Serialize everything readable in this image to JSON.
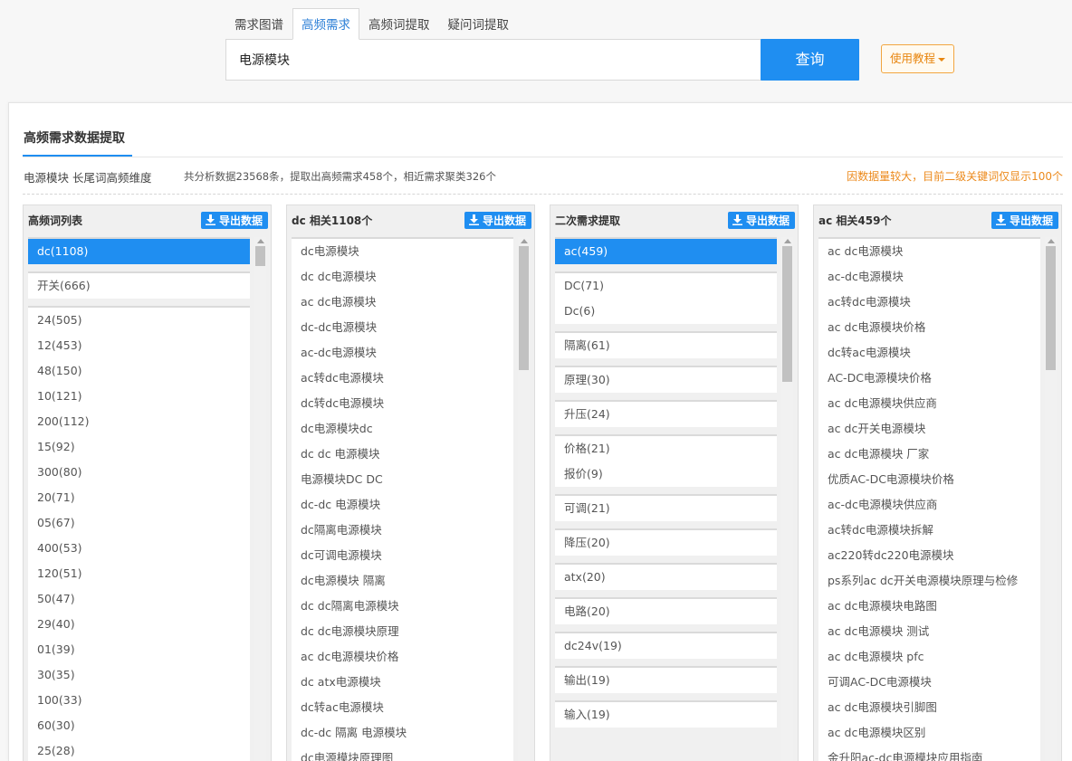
{
  "tabs": [
    "需求图谱",
    "高频需求",
    "高频词提取",
    "疑问词提取"
  ],
  "active_tab_index": 1,
  "search": {
    "value": "电源模块",
    "button_label": "查询"
  },
  "tutorial_label": "使用教程",
  "section": {
    "title": "高频需求数据提取",
    "keyword_dim": "电源模块 长尾词高频维度",
    "stats": "共分析数据23568条，提取出高频需求458个，相近需求聚类326个",
    "note": "因数据量较大，目前二级关键词仅显示100个"
  },
  "colors": {
    "accent": "#1f8ef1",
    "note": "#ec8a1c"
  },
  "export_label": "导出数据",
  "export_icon": "download-icon",
  "col1": {
    "title": "高频词列表",
    "groups": [
      [
        "dc(1108)"
      ],
      [
        "开关(666)"
      ],
      [
        "24(505)",
        "12(453)",
        "48(150)",
        "10(121)",
        "200(112)",
        "15(92)",
        "300(80)",
        "20(71)",
        "05(67)",
        "400(53)",
        "120(51)",
        "50(47)",
        "29(40)",
        "01(39)",
        "30(35)",
        "100(33)",
        "60(30)",
        "25(28)"
      ]
    ],
    "selected": "dc(1108)"
  },
  "col2": {
    "title": "dc 相关1108个",
    "items": [
      "dc电源模块",
      "dc dc电源模块",
      "ac dc电源模块",
      "dc-dc电源模块",
      "ac-dc电源模块",
      "ac转dc电源模块",
      "dc转dc电源模块",
      "dc电源模块dc",
      "dc dc 电源模块",
      "电源模块DC DC",
      "dc-dc 电源模块",
      "dc隔离电源模块",
      "dc可调电源模块",
      "dc电源模块 隔离",
      "dc dc隔离电源模块",
      "dc dc电源模块原理",
      "ac dc电源模块价格",
      "dc atx电源模块",
      "dc转ac电源模块",
      "dc-dc 隔离 电源模块",
      "dc电源模块原理图"
    ]
  },
  "col3": {
    "title": "二次需求提取",
    "groups": [
      [
        "ac(459)"
      ],
      [
        "DC(71)",
        "Dc(6)"
      ],
      [
        "隔离(61)"
      ],
      [
        "原理(30)"
      ],
      [
        "升压(24)"
      ],
      [
        "价格(21)",
        "报价(9)"
      ],
      [
        "可调(21)"
      ],
      [
        "降压(20)"
      ],
      [
        "atx(20)"
      ],
      [
        "电路(20)"
      ],
      [
        "dc24v(19)"
      ],
      [
        "输出(19)"
      ],
      [
        "输入(19)"
      ]
    ],
    "selected": "ac(459)"
  },
  "col4": {
    "title": "ac 相关459个",
    "items": [
      "ac dc电源模块",
      "ac-dc电源模块",
      "ac转dc电源模块",
      "ac dc电源模块价格",
      "dc转ac电源模块",
      "AC-DC电源模块价格",
      "ac dc电源模块供应商",
      "ac dc开关电源模块",
      "ac dc电源模块 厂家",
      "优质AC-DC电源模块价格",
      "ac-dc电源模块供应商",
      "ac转dc电源模块拆解",
      "ac220转dc220电源模块",
      "ps系列ac dc开关电源模块原理与检修",
      "ac dc电源模块电路图",
      "ac dc电源模块 测试",
      "ac dc电源模块 pfc",
      "可调AC-DC电源模块",
      "ac dc电源模块引脚图",
      "ac dc电源模块区别",
      "金升阳ac-dc电源模块应用指南"
    ]
  }
}
